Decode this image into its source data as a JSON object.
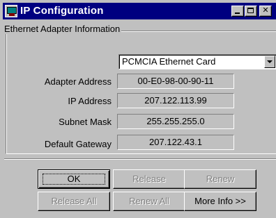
{
  "window": {
    "title": "IP Configuration",
    "icon": "network-config-icon"
  },
  "group": {
    "label": "Ethernet  Adapter Information"
  },
  "adapter_select": {
    "value": "PCMCIA Ethernet Card"
  },
  "fields": [
    {
      "label": "Adapter Address",
      "value": "00-E0-98-00-90-11"
    },
    {
      "label": "IP Address",
      "value": "207.122.113.99"
    },
    {
      "label": "Subnet Mask",
      "value": "255.255.255.0"
    },
    {
      "label": "Default Gateway",
      "value": "207.122.43.1"
    }
  ],
  "buttons": {
    "ok": "OK",
    "release": "Release",
    "renew": "Renew",
    "release_all": "Release All",
    "renew_all": "Renew All",
    "more_info": "More Info >>"
  },
  "colors": {
    "title_bar": "#000080",
    "face": "#c0c0c0"
  }
}
